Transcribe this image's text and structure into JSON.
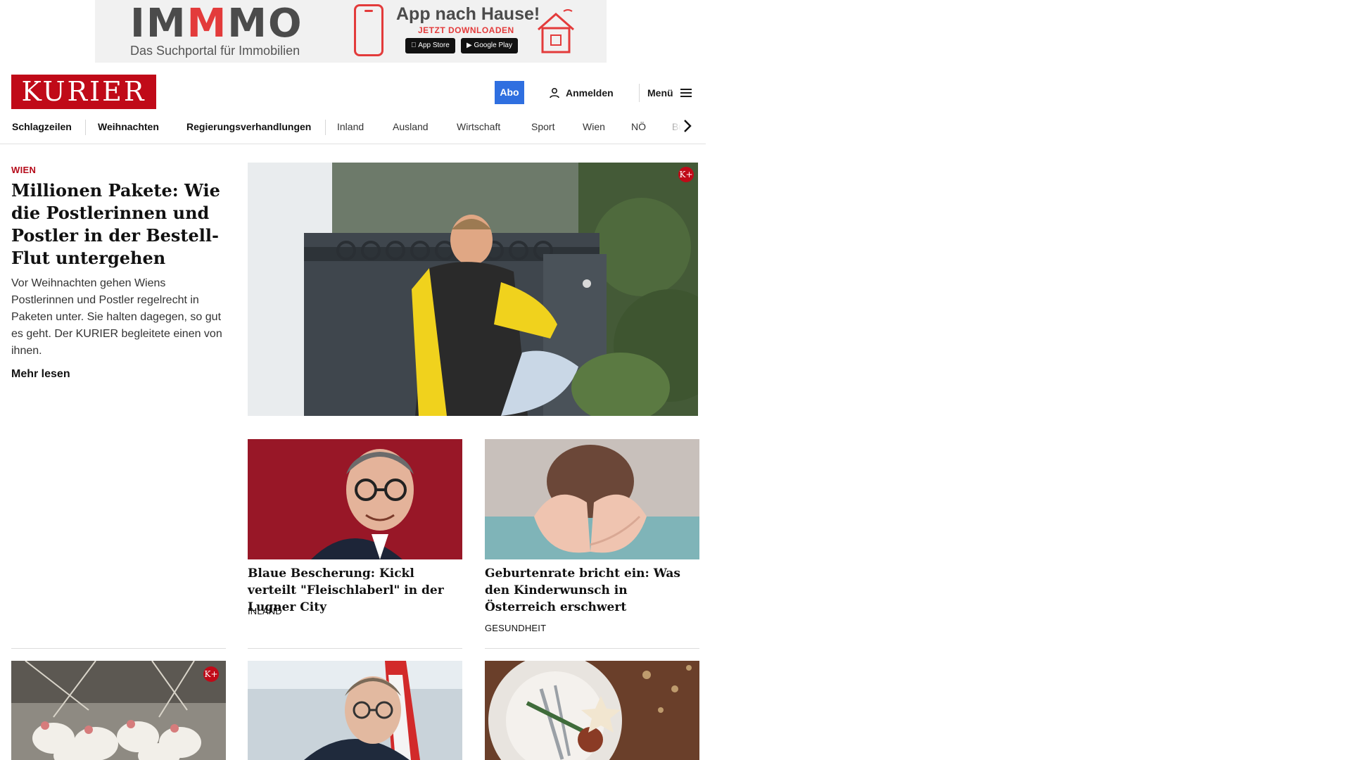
{
  "ad": {
    "brand_left": "IM",
    "brand_red": "M",
    "brand_right": "MO",
    "subtitle": "Das Suchportal für Immobilien",
    "headline": "App nach Hause!",
    "cta": "JETZT DOWNLOADEN",
    "app_store": "App Store",
    "google_play": "Google Play"
  },
  "header": {
    "logo": "KURIER",
    "abo": "Abo",
    "login": "Anmelden",
    "menu": "Menü"
  },
  "nav": {
    "items": [
      "Schlagzeilen",
      "Weihnachten",
      "Regierungsverhandlungen",
      "Inland",
      "Ausland",
      "Wirtschaft",
      "Sport",
      "Wien",
      "NÖ",
      "Bu"
    ]
  },
  "lead": {
    "kicker": "WIEN",
    "title": "Millionen Pakete: Wie die Postlerinnen und Postler in der Bestell-Flut untergehen",
    "teaser": "Vor Weihnachten gehen Wiens Postlerinnen und Postler regelrecht in Paketen unter. Sie halten dagegen, so gut es geht. Der KURIER begleitete einen von ihnen.",
    "more": "Mehr lesen",
    "badge": "K+"
  },
  "cards": [
    {
      "title": "Blaue Bescherung: Kickl verteilt \"Fleischlaberl\" in der Lugner City",
      "category": "INLAND"
    },
    {
      "title": "Geburtenrate bricht ein: Was den Kinderwunsch in Österreich erschwert",
      "category": "GESUNDHEIT"
    }
  ],
  "bottom": {
    "badge": "K+"
  },
  "colors": {
    "brand_red": "#c00a18",
    "abo_blue": "#2f6fe0",
    "kicker_red": "#b50b1a"
  }
}
